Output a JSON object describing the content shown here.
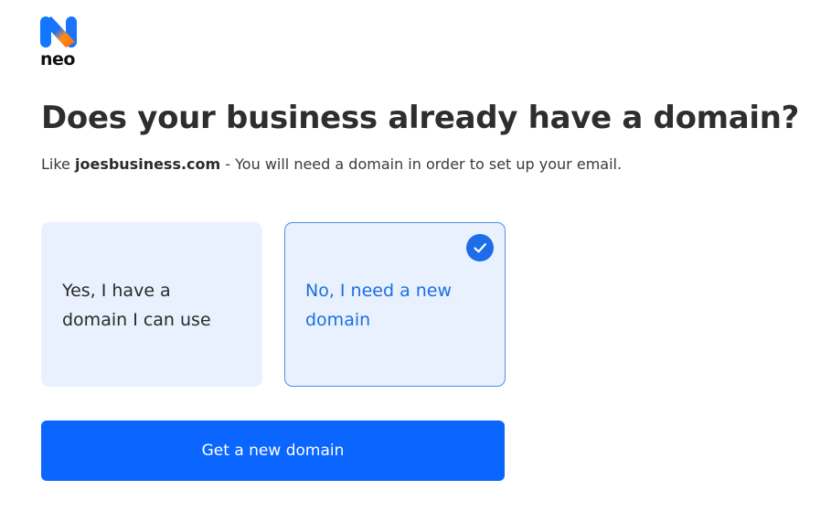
{
  "brand": {
    "name": "neo",
    "logo_icon": "neo-n-logo-icon",
    "colors": {
      "logo_blue": "#0f78ff",
      "logo_orange": "#ff7a1a"
    }
  },
  "question": {
    "title": "Does your business already have a domain?",
    "subtitle_prefix": "Like ",
    "subtitle_example": "joesbusiness.com",
    "subtitle_suffix": " - You will need a domain in order to set up your email."
  },
  "options": [
    {
      "id": "have-domain",
      "label_line1": "Yes, I have a",
      "label_line2": "domain I can use",
      "selected": false
    },
    {
      "id": "need-domain",
      "label_line1": "No, I need a new",
      "label_line2": "domain",
      "selected": true,
      "indicator_icon": "check-circle-icon"
    }
  ],
  "cta": {
    "label": "Get a new domain",
    "color": "#0a66ff"
  },
  "colors": {
    "card_bg": "#e9f1fe",
    "selected_border": "#4a8ff0",
    "selected_text": "#1c6fe0"
  }
}
